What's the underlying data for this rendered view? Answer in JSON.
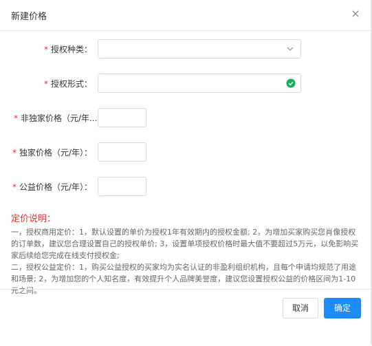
{
  "dialog": {
    "title": "新建价格",
    "close_glyph": "×"
  },
  "form": {
    "required_mark": "*",
    "fields": [
      {
        "label": "授权种类：",
        "type": "select",
        "value": ""
      },
      {
        "label": "授权形式：",
        "type": "input-validated",
        "value": ""
      },
      {
        "label": "非独家价格（元/年...",
        "type": "input",
        "value": ""
      },
      {
        "label": "独家价格（元/年）：",
        "type": "input",
        "value": ""
      },
      {
        "label": "公益价格（元/年）：",
        "type": "input",
        "value": ""
      }
    ]
  },
  "notes": {
    "title": "定价说明：",
    "line1": "一，授权商用定价：1，默认设置的单价为授权1年有效期内的授权金额; 2，为增加买家购买您肖像授权的订单数，建议您合理设置自己的授权单价; 3，设置单项授权价格时最大值不要超过5万元，以免影响买家后续给您完成在线支付授权金;",
    "line2": "二，授权公益定价：1，购买公益授权的买家均为实名认证的非盈利组织机构，且每个申请均规范了用途和场景; 2，为增加您的个人知名度，有效提升个人品牌美誉度，建议您设置授权公益的价格区间为1-10元之间。"
  },
  "footer": {
    "cancel_label": "取消",
    "confirm_label": "确定"
  },
  "colors": {
    "required": "#ee2a2a",
    "note_title": "#e8312f",
    "primary": "#1d8cf8",
    "success": "#1aaa55"
  },
  "icons": {
    "select_arrow": "chevron-down-icon",
    "valid": "check-circle-icon",
    "close": "close-icon"
  }
}
